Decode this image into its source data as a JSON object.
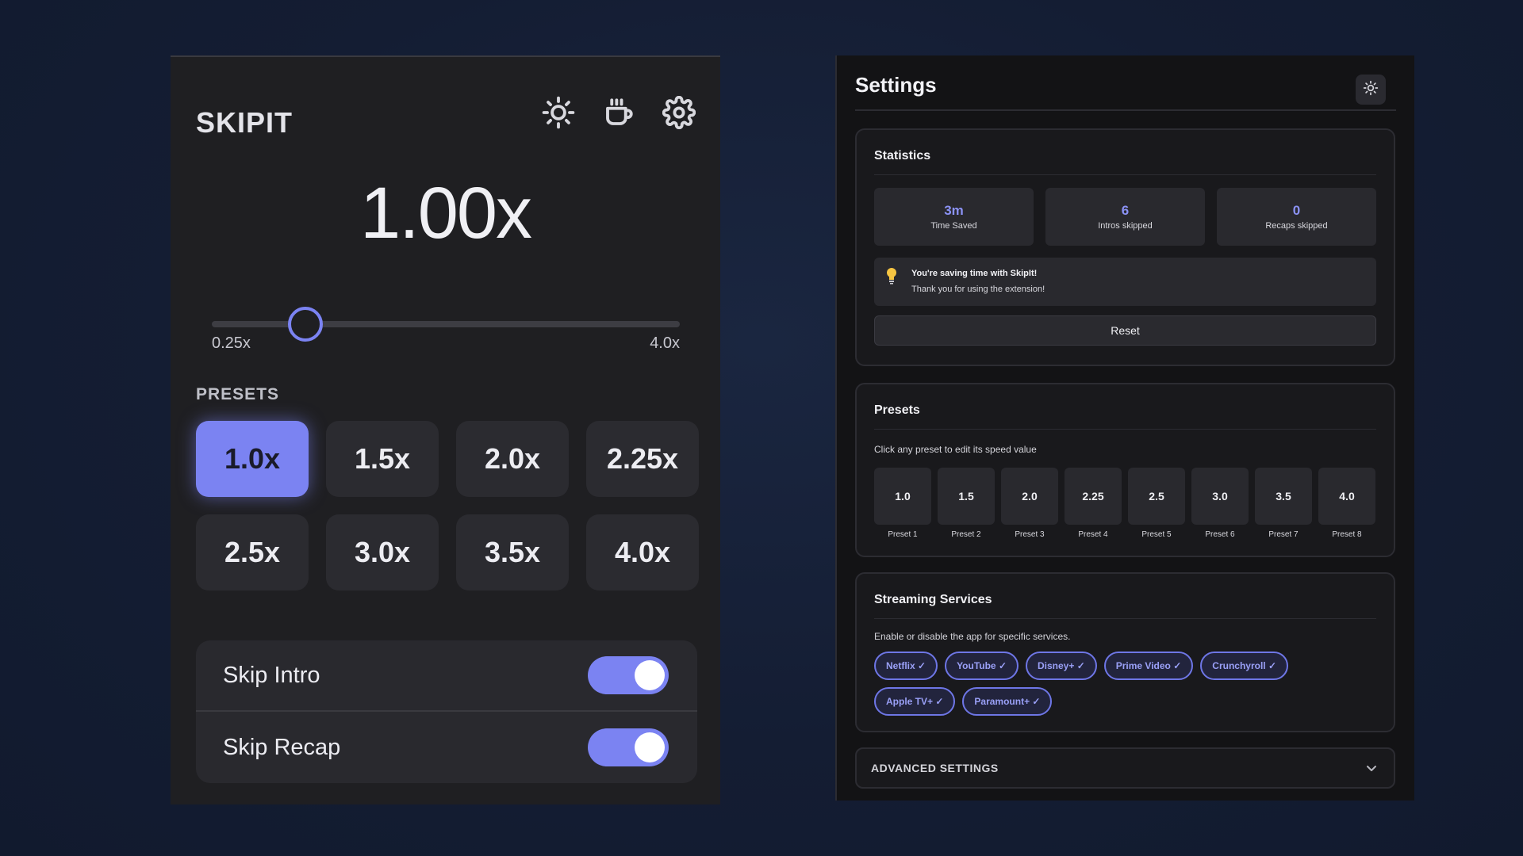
{
  "popup": {
    "brand": "SKIPIT",
    "icons": [
      "sun-icon",
      "coffee-cup-icon",
      "gear-icon"
    ],
    "speed": "1.00x",
    "slider": {
      "min_label": "0.25x",
      "max_label": "4.0x",
      "min": 0.25,
      "max": 4.0,
      "value": 1.0
    },
    "presets_label": "PRESETS",
    "presets": [
      {
        "label": "1.0x",
        "active": true
      },
      {
        "label": "1.5x",
        "active": false
      },
      {
        "label": "2.0x",
        "active": false
      },
      {
        "label": "2.25x",
        "active": false
      },
      {
        "label": "2.5x",
        "active": false
      },
      {
        "label": "3.0x",
        "active": false
      },
      {
        "label": "3.5x",
        "active": false
      },
      {
        "label": "4.0x",
        "active": false
      }
    ],
    "toggles": [
      {
        "label": "Skip Intro",
        "on": true
      },
      {
        "label": "Skip Recap",
        "on": true
      }
    ]
  },
  "settings": {
    "title": "Settings",
    "statistics": {
      "title": "Statistics",
      "stats": [
        {
          "value": "3m",
          "label": "Time Saved"
        },
        {
          "value": "6",
          "label": "Intros skipped"
        },
        {
          "value": "0",
          "label": "Recaps skipped"
        }
      ],
      "info_title": "You're saving time with SkipIt!",
      "info_text": "Thank you for using the extension!",
      "reset_label": "Reset"
    },
    "presets": {
      "title": "Presets",
      "description": "Click any preset to edit its speed value",
      "items": [
        {
          "value": "1.0",
          "label": "Preset 1"
        },
        {
          "value": "1.5",
          "label": "Preset 2"
        },
        {
          "value": "2.0",
          "label": "Preset 3"
        },
        {
          "value": "2.25",
          "label": "Preset 4"
        },
        {
          "value": "2.5",
          "label": "Preset 5"
        },
        {
          "value": "3.0",
          "label": "Preset 6"
        },
        {
          "value": "3.5",
          "label": "Preset 7"
        },
        {
          "value": "4.0",
          "label": "Preset 8"
        }
      ]
    },
    "services": {
      "title": "Streaming Services",
      "description": "Enable or disable the app for specific services.",
      "items": [
        "Netflix ✓",
        "YouTube ✓",
        "Disney+ ✓",
        "Prime Video ✓",
        "Crunchyroll ✓",
        "Apple TV+ ✓",
        "Paramount+ ✓"
      ]
    },
    "advanced_label": "ADVANCED SETTINGS"
  },
  "colors": {
    "accent": "#7b83f2",
    "panel": "#1f1f22",
    "background": "#141d33"
  }
}
